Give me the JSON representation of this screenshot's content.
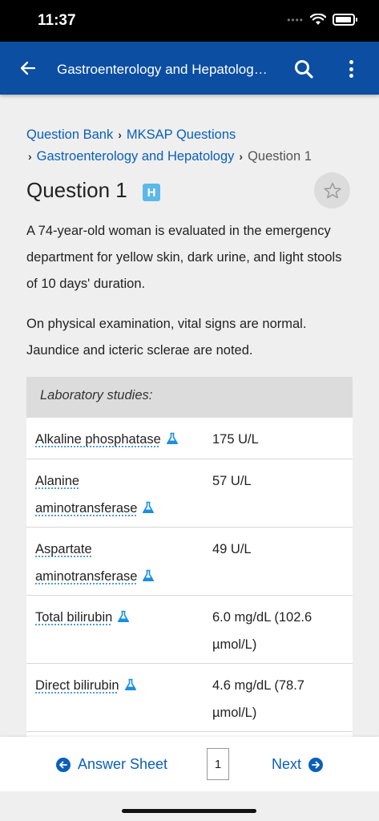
{
  "status_bar": {
    "time": "11:37",
    "signal": "••••"
  },
  "app_bar": {
    "title": "Gastroenterology and Hepatolog…"
  },
  "breadcrumb": {
    "items": [
      "Question Bank",
      "MKSAP Questions",
      "Gastroenterology and Hepatology"
    ],
    "current": "Question 1",
    "separator": "›"
  },
  "question": {
    "title": "Question 1",
    "badge": "H",
    "stem": [
      "A 74-year-old woman is evaluated in the emergency department for yellow skin, dark urine, and light stools of 10 days' duration.",
      "On physical examination, vital signs are normal. Jaundice and icteric sclerae are noted."
    ]
  },
  "lab_studies": {
    "header": "Laboratory studies:",
    "rows": [
      {
        "name": "Alkaline phosphatase",
        "value": "175 U/L"
      },
      {
        "name": "Alanine aminotransferase",
        "value": "57 U/L"
      },
      {
        "name": "Aspartate aminotransferase",
        "value": "49 U/L"
      },
      {
        "name": "Total bilirubin",
        "value": "6.0 mg/dL (102.6 µmol/L)"
      },
      {
        "name": "Direct bilirubin",
        "value": "4.6 mg/dL (78.7 µmol/L)"
      }
    ]
  },
  "bottom_bar": {
    "answer_sheet": "Answer Sheet",
    "page": "1",
    "next": "Next"
  },
  "colors": {
    "primary": "#0b4ea2",
    "link": "#0b5fb8",
    "badge": "#5bb8e8",
    "flask": "#1a8fe0"
  },
  "icons": {
    "back": "arrow-left-icon",
    "search": "search-icon",
    "more": "more-vertical-icon",
    "star": "star-outline-icon",
    "flask": "flask-icon"
  }
}
